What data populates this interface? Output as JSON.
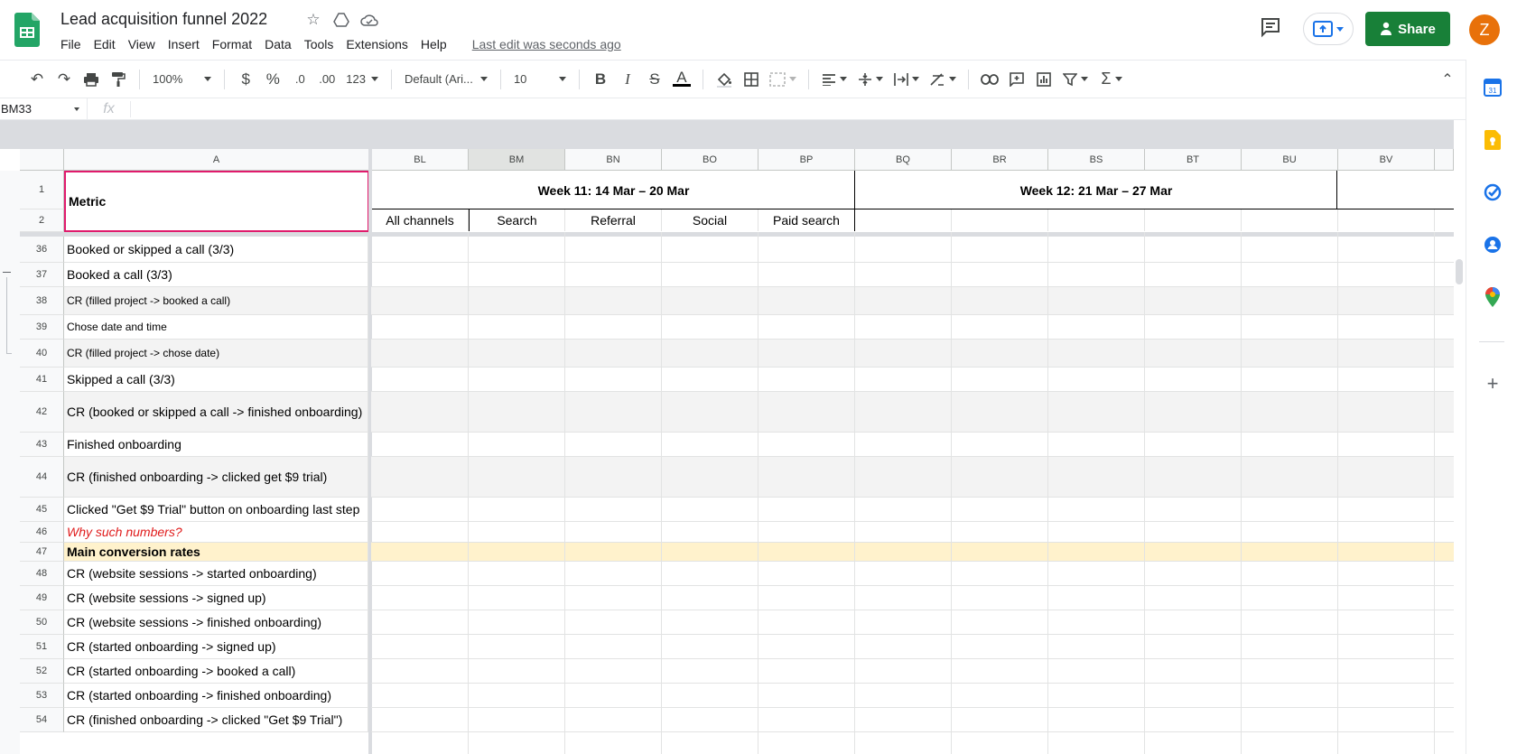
{
  "app": {
    "title": "Lead acquisition funnel 2022",
    "menu": [
      "File",
      "Edit",
      "View",
      "Insert",
      "Format",
      "Data",
      "Tools",
      "Extensions",
      "Help"
    ],
    "last_edit": "Last edit was seconds ago",
    "share_label": "Share",
    "avatar_initial": "Z",
    "colors": {
      "share": "#188038",
      "avatar": "#e8710a",
      "selected_border": "#e01b6c",
      "highlight_row": "#fff2cc",
      "banded_row": "#f3f3f3",
      "red_text": "#e01b1b"
    }
  },
  "toolbar": {
    "zoom": "100%",
    "currency": "$",
    "percent": "%",
    "dec_less": ".0",
    "dec_more": ".00",
    "format_more": "123",
    "font": "Default (Ari...",
    "font_size": "10",
    "icons": [
      "undo-icon",
      "redo-icon",
      "print-icon",
      "paint-format-icon",
      "bold-icon",
      "italic-icon",
      "strikethrough-icon",
      "text-color-icon",
      "fill-color-icon",
      "borders-icon",
      "merge-icon",
      "align-icon",
      "valign-icon",
      "wrap-icon",
      "rotate-icon",
      "link-icon",
      "comment-icon",
      "chart-icon",
      "filter-icon",
      "functions-icon"
    ]
  },
  "formula_bar": {
    "name_box": "BM33",
    "fx": "fx",
    "value": ""
  },
  "columns": [
    "A",
    "BL",
    "BM",
    "BN",
    "BO",
    "BP",
    "BQ",
    "BR",
    "BS",
    "BT",
    "BU",
    "BV"
  ],
  "header_rows": {
    "row1_num": "1",
    "row2_num": "2",
    "metric_label": "Metric",
    "week11": "Week 11: 14 Mar – 20 Mar",
    "week12": "Week 12: 21 Mar – 27 Mar",
    "channels": [
      "All channels",
      "Search",
      "Referral",
      "Social",
      "Paid search"
    ]
  },
  "rows": [
    {
      "num": "36",
      "label": "Booked or skipped a call (3/3)"
    },
    {
      "num": "37",
      "label": "Booked a call (3/3)"
    },
    {
      "num": "38",
      "label": "CR (filled project -> booked a call)"
    },
    {
      "num": "39",
      "label": "Chose date and time"
    },
    {
      "num": "40",
      "label": "CR (filled project -> chose date)"
    },
    {
      "num": "41",
      "label": "Skipped a call (3/3)"
    },
    {
      "num": "42",
      "label": "CR (booked or skipped a call -> finished onboarding)"
    },
    {
      "num": "43",
      "label": "Finished onboarding"
    },
    {
      "num": "44",
      "label": "CR (finished onboarding -> clicked get $9 trial)"
    },
    {
      "num": "45",
      "label": "Clicked \"Get $9 Trial\" button on onboarding last step"
    },
    {
      "num": "46",
      "label": "Why such numbers?"
    },
    {
      "num": "47",
      "label": "Main conversion rates"
    },
    {
      "num": "48",
      "label": "CR (website sessions -> started onboarding)"
    },
    {
      "num": "49",
      "label": "CR (website sessions -> signed up)"
    },
    {
      "num": "50",
      "label": "CR (website sessions -> finished onboarding)"
    },
    {
      "num": "51",
      "label": "CR (started onboarding -> signed up)"
    },
    {
      "num": "52",
      "label": "CR (started onboarding -> booked a call)"
    },
    {
      "num": "53",
      "label": "CR (started onboarding -> finished onboarding)"
    },
    {
      "num": "54",
      "label": "CR (finished onboarding -> clicked \"Get $9 Trial\")"
    }
  ],
  "side_panel": [
    "calendar-icon",
    "keep-icon",
    "tasks-icon",
    "contacts-icon",
    "maps-icon",
    "add-icon"
  ]
}
